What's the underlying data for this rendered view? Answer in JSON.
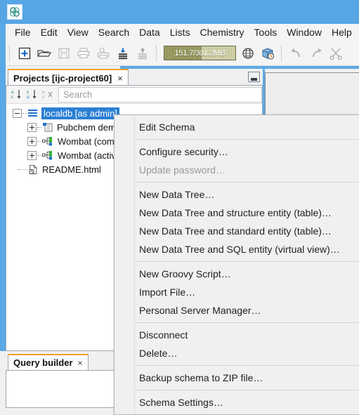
{
  "window": {
    "app_icon": "molecule-logo-icon",
    "title_bar_color": "#56a5e4"
  },
  "menubar": {
    "items": [
      {
        "label": "File"
      },
      {
        "label": "Edit"
      },
      {
        "label": "View"
      },
      {
        "label": "Search"
      },
      {
        "label": "Data"
      },
      {
        "label": "Lists"
      },
      {
        "label": "Chemistry"
      },
      {
        "label": "Tools"
      },
      {
        "label": "Window"
      },
      {
        "label": "Help"
      }
    ]
  },
  "toolbar": {
    "buttons": [
      {
        "name": "new-project-icon",
        "enabled": true
      },
      {
        "name": "open-project-icon",
        "enabled": true
      },
      {
        "name": "save-icon",
        "enabled": false
      },
      {
        "name": "print-icon",
        "enabled": false
      },
      {
        "name": "print-preview-icon",
        "enabled": false
      },
      {
        "name": "import-data-icon",
        "enabled": true
      },
      {
        "name": "export-data-icon",
        "enabled": false
      },
      {
        "name": "globe-icon",
        "enabled": true
      },
      {
        "name": "database-history-icon",
        "enabled": true
      },
      {
        "name": "undo-icon",
        "enabled": false
      },
      {
        "name": "redo-icon",
        "enabled": false
      },
      {
        "name": "cut-icon",
        "enabled": false
      }
    ],
    "memory_gauge": {
      "label": "151.7/301.2MB",
      "used_mb": 151.7,
      "total_mb": 301.2,
      "percent": 50.4
    }
  },
  "projects_panel": {
    "tab_label": "Projects [ijc-project60]",
    "tab_close": "×",
    "minimize_icon": "minimize-window-icon",
    "filter": {
      "sort_az_icon": "sort-a-z-icon",
      "sort_za_icon": "sort-z-a-icon",
      "sort_clear_icon": "sort-clear-icon",
      "search_placeholder": "Search",
      "search_value": ""
    },
    "tree": {
      "root": {
        "label": "localdb [as admin]",
        "icon": "schema-icon",
        "selected": true,
        "expanded": true
      },
      "children": [
        {
          "label": "Pubchem demo",
          "icon": "structure-entity-icon",
          "expanded": false
        },
        {
          "label": "Wombat (comp",
          "icon": "data-tree-icon",
          "expanded": false
        },
        {
          "label": "Wombat (activi",
          "icon": "data-tree-icon",
          "expanded": false
        },
        {
          "label": "README.html",
          "icon": "html-file-icon",
          "expanded": null
        }
      ]
    }
  },
  "query_builder_panel": {
    "tab_label": "Query builder",
    "tab_close": "×"
  },
  "context_menu": {
    "groups": [
      {
        "items": [
          {
            "label": "Edit Schema",
            "enabled": true
          }
        ]
      },
      {
        "items": [
          {
            "label": "Configure security…",
            "enabled": true
          },
          {
            "label": "Update password…",
            "enabled": false
          }
        ]
      },
      {
        "items": [
          {
            "label": "New Data Tree…",
            "enabled": true
          },
          {
            "label": "New Data Tree and structure entity (table)…",
            "enabled": true
          },
          {
            "label": "New Data Tree and standard entity (table)…",
            "enabled": true
          },
          {
            "label": "New Data Tree and SQL entity (virtual view)…",
            "enabled": true
          }
        ]
      },
      {
        "items": [
          {
            "label": "New Groovy Script…",
            "enabled": true
          },
          {
            "label": "Import File…",
            "enabled": true
          },
          {
            "label": "Personal Server Manager…",
            "enabled": true
          }
        ]
      },
      {
        "items": [
          {
            "label": "Disconnect",
            "enabled": true
          },
          {
            "label": "Delete…",
            "enabled": true
          }
        ]
      },
      {
        "items": [
          {
            "label": "Backup schema to ZIP file…",
            "enabled": true
          }
        ]
      },
      {
        "items": [
          {
            "label": "Schema Settings…",
            "enabled": true
          }
        ]
      }
    ]
  },
  "colors": {
    "accent_blue": "#2a7fd4",
    "title_blue": "#56a5e4",
    "tab_orange": "#f0a030",
    "panel_gray": "#f0f0f0"
  }
}
